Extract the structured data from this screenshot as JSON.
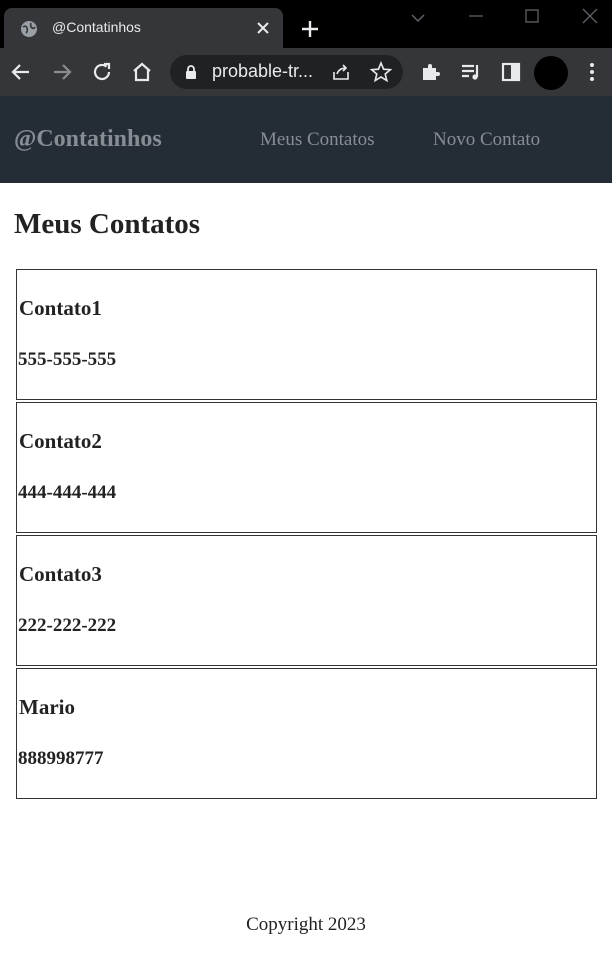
{
  "browser": {
    "tab_title": "@Contatinhos",
    "url": "probable-tr..."
  },
  "navbar": {
    "brand": "@Contatinhos",
    "links": [
      "Meus Contatos",
      "Novo Contato"
    ]
  },
  "main": {
    "title": "Meus Contatos",
    "contacts": [
      {
        "name": "Contato1",
        "phone": "555-555-555"
      },
      {
        "name": "Contato2",
        "phone": "444-444-444"
      },
      {
        "name": "Contato3",
        "phone": "222-222-222"
      },
      {
        "name": "Mario",
        "phone": "888998777"
      }
    ]
  },
  "footer": {
    "text": "Copyright 2023"
  },
  "colors": {
    "navbar_bg": "#242d35",
    "nav_text": "#878d93",
    "chrome_bg": "#35363a"
  },
  "icons": [
    "globe-icon",
    "close-icon",
    "plus-icon",
    "chevron-down-icon",
    "minimize-icon",
    "maximize-icon",
    "window-close-icon",
    "back-arrow-icon",
    "forward-arrow-icon",
    "reload-icon",
    "home-icon",
    "lock-icon",
    "share-icon",
    "star-icon",
    "puzzle-icon",
    "media-icon",
    "sidebar-icon",
    "kebab-menu-icon"
  ]
}
